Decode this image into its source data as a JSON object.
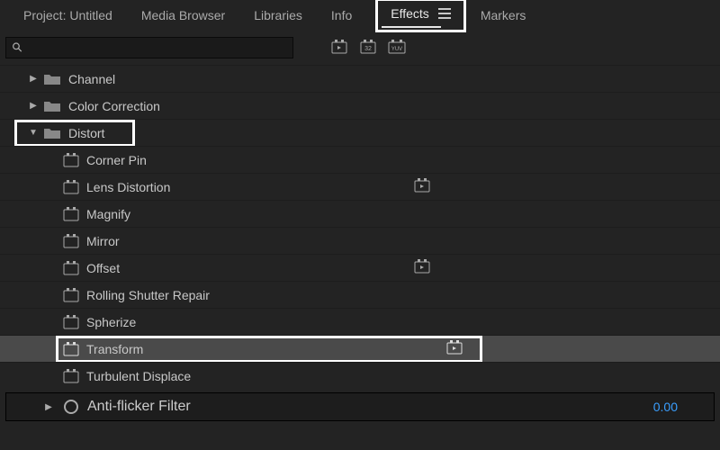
{
  "tabs": {
    "project": "Project: Untitled",
    "mediaBrowser": "Media Browser",
    "libraries": "Libraries",
    "info": "Info",
    "effects": "Effects",
    "markers": "Markers"
  },
  "search": {
    "placeholder": ""
  },
  "toolbarIcons": {
    "accelerated": "▸",
    "frame32": "32",
    "yuv": "YUV"
  },
  "tree": {
    "channel": "Channel",
    "colorCorrection": "Color Correction",
    "distort": "Distort",
    "items": [
      "Corner Pin",
      "Lens Distortion",
      "Magnify",
      "Mirror",
      "Offset",
      "Rolling Shutter Repair",
      "Spherize",
      "Transform",
      "Turbulent Displace"
    ]
  },
  "bottom": {
    "antiFlicker": "Anti-flicker Filter",
    "value": "0.00"
  }
}
